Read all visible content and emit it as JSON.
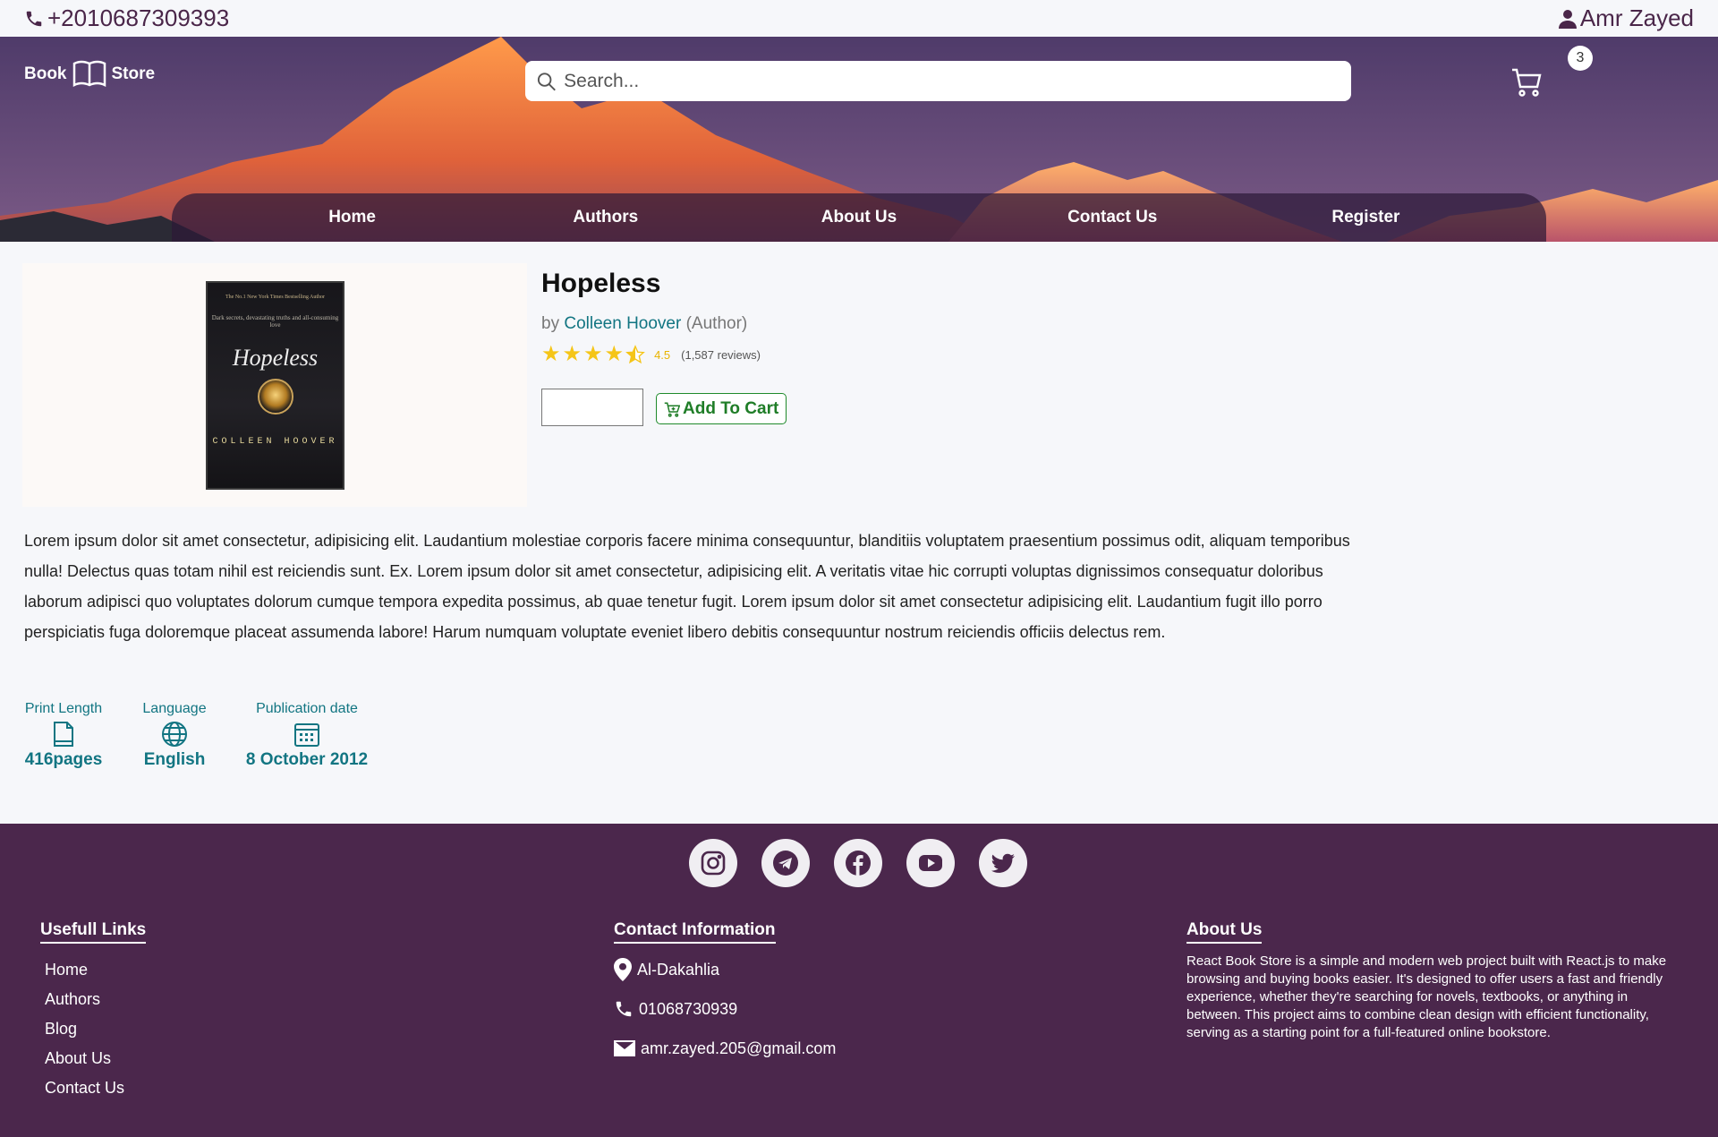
{
  "topbar": {
    "phone": "+2010687309393",
    "user": "Amr Zayed"
  },
  "header": {
    "brand_left": "Book",
    "brand_right": "Store",
    "search_placeholder": "Search...",
    "cart_count": "3"
  },
  "nav": [
    "Home",
    "Authors",
    "About Us",
    "Contact Us",
    "Register"
  ],
  "book": {
    "cover_tagline": "The No.1 New York Times Bestselling Author",
    "cover_blurb": "Dark secrets, devastating truths and all-consuming love",
    "cover_title": "Hopeless",
    "cover_author": "COLLEEN HOOVER",
    "title": "Hopeless",
    "by": "by",
    "author": "Colleen Hoover",
    "author_role": "(Author)",
    "rating": 4.5,
    "rating_text": "4.5",
    "reviews": "(1,587 reviews)",
    "add_to_cart": "Add To Cart",
    "description": "Lorem ipsum dolor sit amet consectetur, adipisicing elit. Laudantium molestiae corporis facere minima consequuntur, blanditiis voluptatem praesentium possimus odit, aliquam temporibus nulla! Delectus quas totam nihil est reiciendis sunt. Ex. Lorem ipsum dolor sit amet consectetur, adipisicing elit. A veritatis vitae hic corrupti voluptas dignissimos consequatur doloribus laborum adipisci quo voluptates dolorum cumque tempora expedita possimus, ab quae tenetur fugit. Lorem ipsum dolor sit amet consectetur adipisicing elit. Laudantium fugit illo porro perspiciatis fuga doloremque placeat assumenda labore! Harum numquam voluptate eveniet libero debitis consequuntur nostrum reiciendis officiis delectus rem."
  },
  "details": [
    {
      "label": "Print Length",
      "value": "416pages",
      "icon": "document-icon"
    },
    {
      "label": "Language",
      "value": "English",
      "icon": "globe-icon"
    },
    {
      "label": "Publication date",
      "value": "8 October 2012",
      "icon": "calendar-icon"
    }
  ],
  "footer": {
    "socials": [
      "instagram-icon",
      "telegram-icon",
      "facebook-icon",
      "youtube-icon",
      "twitter-icon"
    ],
    "links_title": "Usefull Links",
    "links": [
      "Home",
      "Authors",
      "Blog",
      "About Us",
      "Contact Us"
    ],
    "contact_title": "Contact Information",
    "address": "Al-Dakahlia",
    "phone": "01068730939",
    "email": "amr.zayed.205@gmail.com",
    "about_title": "About Us",
    "about_text": "React Book Store is a simple and modern web project built with React.js to make browsing and buying books easier. It's designed to offer users a fast and friendly experience, whether they're searching for novels, textbooks, or anything in between. This project aims to combine clean design with efficient functionality, serving as a starting point for a full-featured online bookstore."
  },
  "colors": {
    "primary": "#4b274c",
    "teal": "#127582",
    "star": "#f5c518",
    "add_green": "#1f7d27"
  }
}
